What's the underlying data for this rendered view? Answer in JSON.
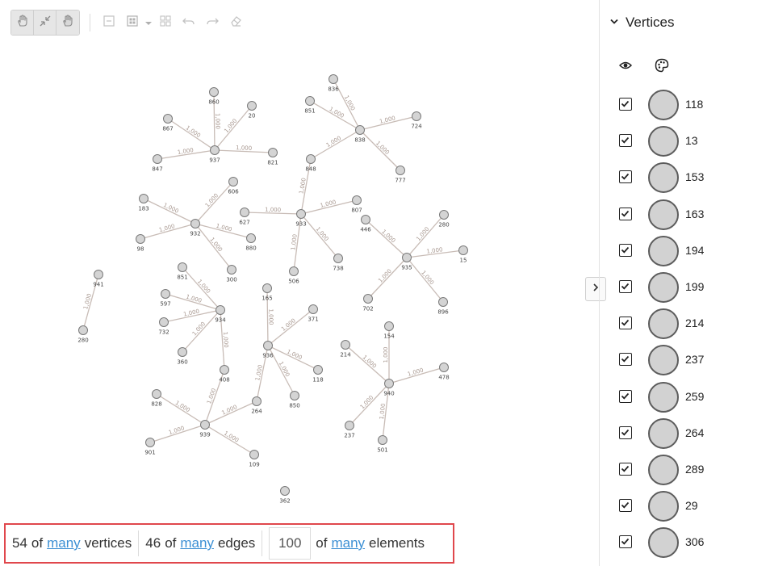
{
  "toolbar": {
    "tools": [
      "pan-hand-icon",
      "collapse-icon",
      "select-hand-icon",
      "minus-box-icon",
      "grid-layout-icon",
      "dropdown-caret-icon",
      "apps-icon",
      "undo-icon",
      "redo-icon",
      "eraser-icon"
    ]
  },
  "colors": {
    "node_fill": "#d4d4d4",
    "node_stroke": "#7a7a7a",
    "edge": "#c8bcb6",
    "edge_label": "#a89890",
    "link": "#3b8fd4",
    "highlight_border": "#e0474c"
  },
  "graph": {
    "edge_label": "1,000",
    "nodes": [
      {
        "id": "n937",
        "label": "937"
      },
      {
        "id": "n860",
        "label": "860"
      },
      {
        "id": "n867",
        "label": "867"
      },
      {
        "id": "n20",
        "label": "20"
      },
      {
        "id": "n847",
        "label": "847"
      },
      {
        "id": "n821",
        "label": "821"
      },
      {
        "id": "n838",
        "label": "838"
      },
      {
        "id": "n836",
        "label": "836"
      },
      {
        "id": "n851",
        "label": "851"
      },
      {
        "id": "n724",
        "label": "724"
      },
      {
        "id": "n848",
        "label": "848"
      },
      {
        "id": "n777",
        "label": "777"
      },
      {
        "id": "n932",
        "label": "932"
      },
      {
        "id": "n183",
        "label": "183"
      },
      {
        "id": "n606",
        "label": "606"
      },
      {
        "id": "n98",
        "label": "98"
      },
      {
        "id": "n880",
        "label": "880"
      },
      {
        "id": "n300",
        "label": "300"
      },
      {
        "id": "n933",
        "label": "933"
      },
      {
        "id": "n627",
        "label": "627"
      },
      {
        "id": "n807",
        "label": "807"
      },
      {
        "id": "n506",
        "label": "506"
      },
      {
        "id": "n738",
        "label": "738"
      },
      {
        "id": "n935",
        "label": "935"
      },
      {
        "id": "n446",
        "label": "446"
      },
      {
        "id": "n280",
        "label": "280"
      },
      {
        "id": "n15",
        "label": "15"
      },
      {
        "id": "n702",
        "label": "702"
      },
      {
        "id": "n896",
        "label": "896"
      },
      {
        "id": "n941",
        "label": "941"
      },
      {
        "id": "n280b",
        "label": "280"
      },
      {
        "id": "n934",
        "label": "934"
      },
      {
        "id": "n851b",
        "label": "851"
      },
      {
        "id": "n597",
        "label": "597"
      },
      {
        "id": "n732",
        "label": "732"
      },
      {
        "id": "n360",
        "label": "360"
      },
      {
        "id": "n408",
        "label": "408"
      },
      {
        "id": "n936",
        "label": "936"
      },
      {
        "id": "n165",
        "label": "165"
      },
      {
        "id": "n371",
        "label": "371"
      },
      {
        "id": "n118",
        "label": "118"
      },
      {
        "id": "n264",
        "label": "264"
      },
      {
        "id": "n850",
        "label": "850"
      },
      {
        "id": "n940",
        "label": "940"
      },
      {
        "id": "n154",
        "label": "154"
      },
      {
        "id": "n214",
        "label": "214"
      },
      {
        "id": "n478",
        "label": "478"
      },
      {
        "id": "n237",
        "label": "237"
      },
      {
        "id": "n501",
        "label": "501"
      },
      {
        "id": "n939",
        "label": "939"
      },
      {
        "id": "n828",
        "label": "828"
      },
      {
        "id": "n901",
        "label": "901"
      },
      {
        "id": "n109",
        "label": "109"
      },
      {
        "id": "n362",
        "label": "362"
      }
    ],
    "edges": [
      [
        "n937",
        "n860"
      ],
      [
        "n937",
        "n867"
      ],
      [
        "n937",
        "n20"
      ],
      [
        "n937",
        "n847"
      ],
      [
        "n937",
        "n821"
      ],
      [
        "n838",
        "n836"
      ],
      [
        "n838",
        "n851"
      ],
      [
        "n838",
        "n724"
      ],
      [
        "n838",
        "n848"
      ],
      [
        "n838",
        "n777"
      ],
      [
        "n932",
        "n183"
      ],
      [
        "n932",
        "n606"
      ],
      [
        "n932",
        "n98"
      ],
      [
        "n932",
        "n880"
      ],
      [
        "n932",
        "n300"
      ],
      [
        "n933",
        "n627"
      ],
      [
        "n933",
        "n807"
      ],
      [
        "n933",
        "n506"
      ],
      [
        "n933",
        "n738"
      ],
      [
        "n933",
        "n848"
      ],
      [
        "n935",
        "n446"
      ],
      [
        "n935",
        "n280"
      ],
      [
        "n935",
        "n15"
      ],
      [
        "n935",
        "n702"
      ],
      [
        "n935",
        "n896"
      ],
      [
        "n941",
        "n280b"
      ],
      [
        "n934",
        "n851b"
      ],
      [
        "n934",
        "n597"
      ],
      [
        "n934",
        "n732"
      ],
      [
        "n934",
        "n360"
      ],
      [
        "n934",
        "n408"
      ],
      [
        "n936",
        "n165"
      ],
      [
        "n936",
        "n371"
      ],
      [
        "n936",
        "n118"
      ],
      [
        "n936",
        "n264"
      ],
      [
        "n936",
        "n850"
      ],
      [
        "n940",
        "n154"
      ],
      [
        "n940",
        "n214"
      ],
      [
        "n940",
        "n478"
      ],
      [
        "n940",
        "n237"
      ],
      [
        "n940",
        "n501"
      ],
      [
        "n939",
        "n828"
      ],
      [
        "n939",
        "n901"
      ],
      [
        "n939",
        "n109"
      ],
      [
        "n939",
        "n264"
      ],
      [
        "n939",
        "n408"
      ]
    ]
  },
  "panel": {
    "title": "Vertices",
    "visibility_icon": "eye-icon",
    "color_icon": "palette-icon",
    "vertices": [
      {
        "label": "118",
        "checked": true
      },
      {
        "label": "13",
        "checked": true
      },
      {
        "label": "153",
        "checked": true
      },
      {
        "label": "163",
        "checked": true
      },
      {
        "label": "194",
        "checked": true
      },
      {
        "label": "199",
        "checked": true
      },
      {
        "label": "214",
        "checked": true
      },
      {
        "label": "237",
        "checked": true
      },
      {
        "label": "259",
        "checked": true
      },
      {
        "label": "264",
        "checked": true
      },
      {
        "label": "289",
        "checked": true
      },
      {
        "label": "29",
        "checked": true
      },
      {
        "label": "306",
        "checked": true
      }
    ]
  },
  "status": {
    "vertices_count": "54",
    "of_label": "of",
    "many_label": "many",
    "vertices_label": "vertices",
    "edges_count": "46",
    "edges_label": "edges",
    "limit_value": "100",
    "elements_label": "elements"
  }
}
